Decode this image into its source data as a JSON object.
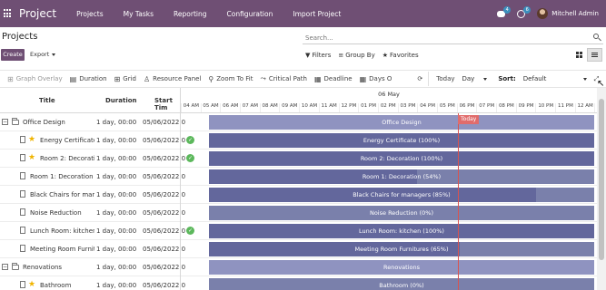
{
  "navbar": {
    "brand": "Project",
    "menu": [
      "Projects",
      "My Tasks",
      "Reporting",
      "Configuration",
      "Import Project"
    ],
    "chat_badge": "4",
    "activity_badge": "6",
    "user_name": "Mitchell Admin"
  },
  "control_panel": {
    "title": "Projects",
    "search_placeholder": "Search...",
    "create_label": "Create",
    "export_label": "Export",
    "filters_label": "Filters",
    "group_by_label": "Group By",
    "favorites_label": "Favorites"
  },
  "toolbar": {
    "graph_overlay": "Graph Overlay",
    "duration": "Duration",
    "grid": "Grid",
    "resource_panel": "Resource Panel",
    "zoom_to_fit": "Zoom To Fit",
    "critical_path": "Critical Path",
    "deadline": "Deadline",
    "days_off": "Days O",
    "today": "Today",
    "scale": "Day",
    "sort_label": "Sort:",
    "sort_value": "Default"
  },
  "gantt": {
    "columns": {
      "title": "Title",
      "duration": "Duration",
      "start": "Start Tim"
    },
    "day_label": "06 May",
    "hours": [
      "04 AM",
      "05 AM",
      "06 AM",
      "07 AM",
      "08 AM",
      "09 AM",
      "10 AM",
      "11 AM",
      "12 PM",
      "01 PM",
      "02 PM",
      "03 PM",
      "04 PM",
      "05 PM",
      "06 PM",
      "07 PM",
      "08 PM",
      "09 PM",
      "10 PM",
      "11 PM",
      "12 AM",
      "01 AM",
      "02 AM"
    ],
    "today_label": "Today",
    "rows": [
      {
        "title": "Office Design",
        "duration": "1 day, 00:00",
        "start": "05/06/2022 0",
        "bar_label": "Office Design",
        "progress": null,
        "group": true
      },
      {
        "title": "Energy Certificate",
        "duration": "1 day, 00:00",
        "start": "05/06/2022 0",
        "bar_label": "Energy Certificate (100%)",
        "progress": 100,
        "star": true,
        "check": true
      },
      {
        "title": "Room 2: Decoration",
        "duration": "1 day, 00:00",
        "start": "05/06/2022 0",
        "bar_label": "Room 2: Decoration (100%)",
        "progress": 100,
        "star": true,
        "check": true
      },
      {
        "title": "Room 1: Decoration",
        "duration": "1 day, 00:00",
        "start": "05/06/2022 0",
        "bar_label": "Room 1: Decoration (54%)",
        "progress": 54
      },
      {
        "title": "Black Chairs for manag",
        "duration": "1 day, 00:00",
        "start": "05/06/2022 0",
        "bar_label": "Black Chairs for managers (85%)",
        "progress": 85
      },
      {
        "title": "Noise Reduction",
        "duration": "1 day, 00:00",
        "start": "05/06/2022 0",
        "bar_label": "Noise Reduction (0%)",
        "progress": 0
      },
      {
        "title": "Lunch Room: kitchen",
        "duration": "1 day, 00:00",
        "start": "05/06/2022 0",
        "bar_label": "Lunch Room: kitchen (100%)",
        "progress": 100,
        "check": true
      },
      {
        "title": "Meeting Room Furnitur",
        "duration": "1 day, 00:00",
        "start": "05/06/2022 0",
        "bar_label": "Meeting Room Furnitures (65%)",
        "progress": 65
      },
      {
        "title": "Renovations",
        "duration": "1 day, 00:00",
        "start": "05/06/2022 0",
        "bar_label": "Renovations",
        "progress": null,
        "group": true
      },
      {
        "title": "Bathroom",
        "duration": "1 day, 00:00",
        "start": "05/06/2022 0",
        "bar_label": "Bathroom (0%)",
        "progress": 0,
        "star": true
      }
    ]
  },
  "colors": {
    "navbar": "#6f4f74",
    "bar": "#7a80ab",
    "bar_fill": "#63679c",
    "today": "#d9534f",
    "check": "#5cb85c",
    "star": "#f0b400"
  }
}
